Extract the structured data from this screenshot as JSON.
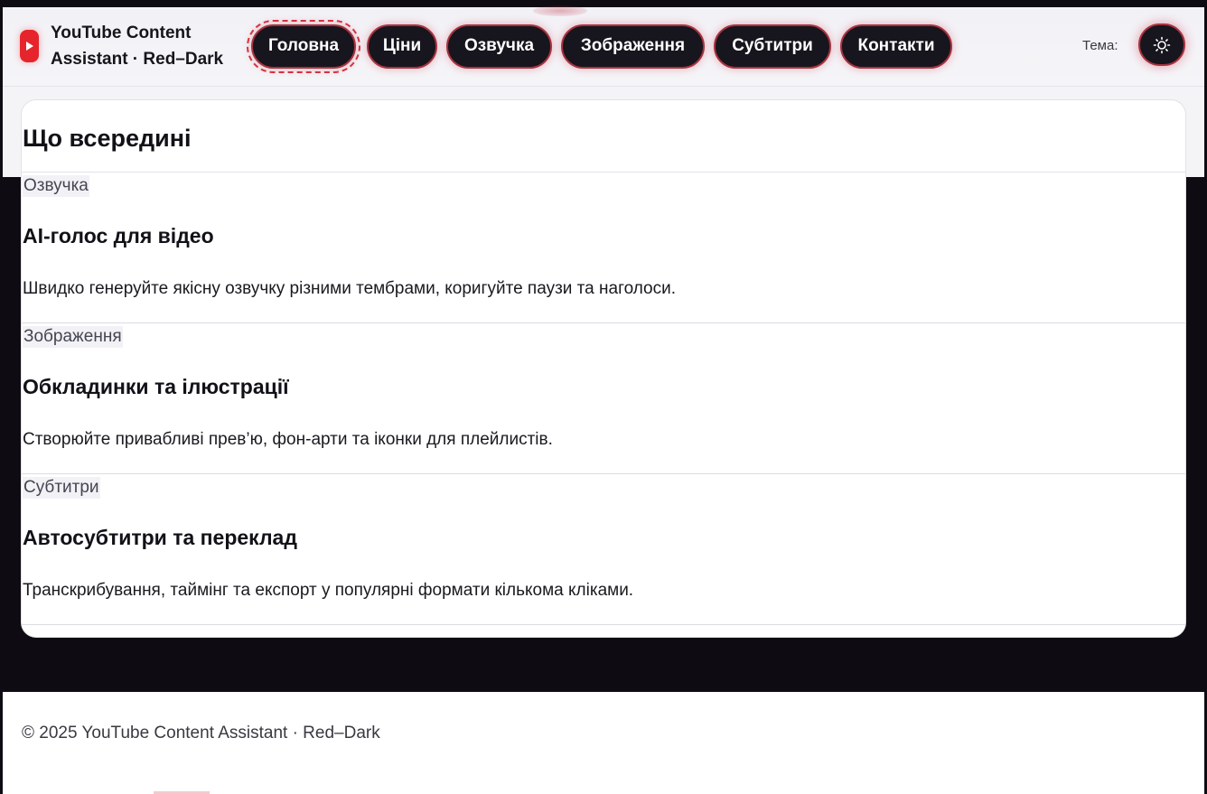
{
  "brand": {
    "title": "YouTube Content Assistant · Red–Dark",
    "logo_icon": "play-icon",
    "accent_color": "#e5252b"
  },
  "nav": {
    "items": [
      {
        "label": "Головна",
        "active": true
      },
      {
        "label": "Ціни",
        "active": false
      },
      {
        "label": "Озвучка",
        "active": false
      },
      {
        "label": "Зображення",
        "active": false
      },
      {
        "label": "Субтитри",
        "active": false
      },
      {
        "label": "Контакти",
        "active": false
      }
    ]
  },
  "theme": {
    "label": "Тема:",
    "toggle_icon": "sun-icon"
  },
  "main": {
    "title": "Що всередині",
    "features": [
      {
        "tag": "Озвучка",
        "heading": "AI-голос для відео",
        "description": "Швидко генеруйте якісну озвучку різними тембрами, коригуйте паузи та наголоси."
      },
      {
        "tag": "Зображення",
        "heading": "Обкладинки та ілюстрації",
        "description": "Створюйте привабливі прев’ю, фон-арти та іконки для плейлистів."
      },
      {
        "tag": "Субтитри",
        "heading": "Автосубтитри та переклад",
        "description": "Транскрибування, таймінг та експорт у популярні формати кількома кліками."
      }
    ]
  },
  "footer": {
    "text": "© 2025 YouTube Content Assistant · Red–Dark"
  }
}
